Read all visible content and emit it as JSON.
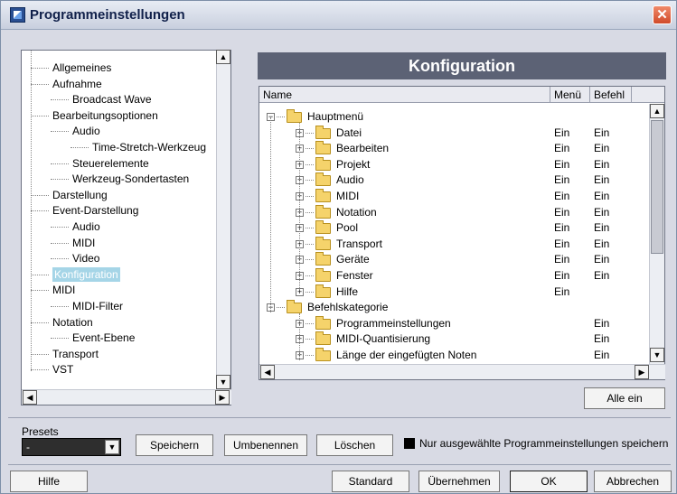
{
  "window": {
    "title": "Programmeinstellungen"
  },
  "tree": {
    "items": [
      {
        "label": "Allgemeines",
        "level": 0
      },
      {
        "label": "Aufnahme",
        "level": 0
      },
      {
        "label": "Broadcast Wave",
        "level": 1
      },
      {
        "label": "Bearbeitungsoptionen",
        "level": 0
      },
      {
        "label": "Audio",
        "level": 1
      },
      {
        "label": "Time-Stretch-Werkzeug",
        "level": 2
      },
      {
        "label": "Steuerelemente",
        "level": 1
      },
      {
        "label": "Werkzeug-Sondertasten",
        "level": 1
      },
      {
        "label": "Darstellung",
        "level": 0
      },
      {
        "label": "Event-Darstellung",
        "level": 0
      },
      {
        "label": "Audio",
        "level": 1
      },
      {
        "label": "MIDI",
        "level": 1
      },
      {
        "label": "Video",
        "level": 1
      },
      {
        "label": "Konfiguration",
        "level": 0,
        "selected": true
      },
      {
        "label": "MIDI",
        "level": 0
      },
      {
        "label": "MIDI-Filter",
        "level": 1
      },
      {
        "label": "Notation",
        "level": 0
      },
      {
        "label": "Event-Ebene",
        "level": 1
      },
      {
        "label": "Transport",
        "level": 0
      },
      {
        "label": "VST",
        "level": 0
      }
    ]
  },
  "main": {
    "header": "Konfiguration",
    "columns": {
      "name": "Name",
      "menu": "Menü",
      "command": "Befehl"
    },
    "rows": [
      {
        "label": "Hauptmenü",
        "level": 0,
        "expand": "-",
        "menu": "",
        "command": ""
      },
      {
        "label": "Datei",
        "level": 1,
        "expand": "+",
        "menu": "Ein",
        "command": "Ein"
      },
      {
        "label": "Bearbeiten",
        "level": 1,
        "expand": "+",
        "menu": "Ein",
        "command": "Ein"
      },
      {
        "label": "Projekt",
        "level": 1,
        "expand": "+",
        "menu": "Ein",
        "command": "Ein"
      },
      {
        "label": "Audio",
        "level": 1,
        "expand": "+",
        "menu": "Ein",
        "command": "Ein"
      },
      {
        "label": "MIDI",
        "level": 1,
        "expand": "+",
        "menu": "Ein",
        "command": "Ein"
      },
      {
        "label": "Notation",
        "level": 1,
        "expand": "+",
        "menu": "Ein",
        "command": "Ein"
      },
      {
        "label": "Pool",
        "level": 1,
        "expand": "+",
        "menu": "Ein",
        "command": "Ein"
      },
      {
        "label": "Transport",
        "level": 1,
        "expand": "+",
        "menu": "Ein",
        "command": "Ein"
      },
      {
        "label": "Geräte",
        "level": 1,
        "expand": "+",
        "menu": "Ein",
        "command": "Ein"
      },
      {
        "label": "Fenster",
        "level": 1,
        "expand": "+",
        "menu": "Ein",
        "command": "Ein"
      },
      {
        "label": "Hilfe",
        "level": 1,
        "expand": "+",
        "menu": "Ein",
        "command": ""
      },
      {
        "label": "Befehlskategorie",
        "level": 0,
        "expand": "-",
        "menu": "",
        "command": ""
      },
      {
        "label": "Programmeinstellungen",
        "level": 1,
        "expand": "+",
        "menu": "",
        "command": "Ein"
      },
      {
        "label": "MIDI-Quantisierung",
        "level": 1,
        "expand": "+",
        "menu": "",
        "command": "Ein"
      },
      {
        "label": "Länge der eingefügten Noten",
        "level": 1,
        "expand": "+",
        "menu": "",
        "command": "Ein"
      }
    ],
    "all_on_label": "Alle ein"
  },
  "presets": {
    "label": "Presets",
    "value": "-",
    "save_label": "Speichern",
    "rename_label": "Umbenennen",
    "delete_label": "Löschen",
    "checkbox_label": "Nur ausgewählte Programmeinstellungen speichern"
  },
  "footer": {
    "help_label": "Hilfe",
    "standard_label": "Standard",
    "apply_label": "Übernehmen",
    "ok_label": "OK",
    "cancel_label": "Abbrechen"
  }
}
